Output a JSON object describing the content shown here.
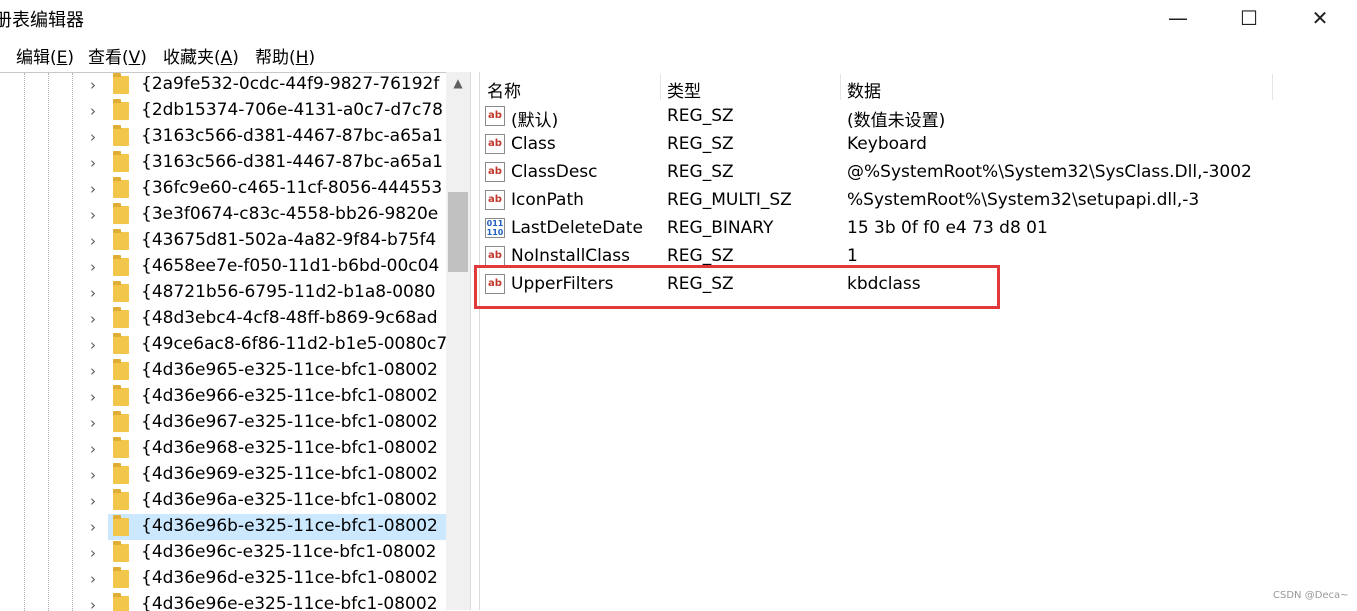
{
  "window": {
    "title": "册表编辑器",
    "minimize_glyph": "—",
    "maximize_glyph": "☐",
    "close_glyph": "✕"
  },
  "menu": [
    {
      "label": "编辑(",
      "accel": "E",
      "tail": ")"
    },
    {
      "label": "查看(",
      "accel": "V",
      "tail": ")"
    },
    {
      "label": "收藏夹(",
      "accel": "A",
      "tail": ")"
    },
    {
      "label": "帮助(",
      "accel": "H",
      "tail": ")"
    }
  ],
  "tree": {
    "expand_glyph": "›",
    "selected_index": 17,
    "items": [
      "{2a9fe532-0cdc-44f9-9827-76192f",
      "{2db15374-706e-4131-a0c7-d7c78",
      "{3163c566-d381-4467-87bc-a65a1",
      "{3163c566-d381-4467-87bc-a65a1",
      "{36fc9e60-c465-11cf-8056-444553",
      "{3e3f0674-c83c-4558-bb26-9820e",
      "{43675d81-502a-4a82-9f84-b75f4",
      "{4658ee7e-f050-11d1-b6bd-00c04",
      "{48721b56-6795-11d2-b1a8-0080",
      "{48d3ebc4-4cf8-48ff-b869-9c68ad",
      "{49ce6ac8-6f86-11d2-b1e5-0080c7",
      "{4d36e965-e325-11ce-bfc1-08002",
      "{4d36e966-e325-11ce-bfc1-08002",
      "{4d36e967-e325-11ce-bfc1-08002",
      "{4d36e968-e325-11ce-bfc1-08002",
      "{4d36e969-e325-11ce-bfc1-08002",
      "{4d36e96a-e325-11ce-bfc1-08002",
      "{4d36e96b-e325-11ce-bfc1-08002",
      "{4d36e96c-e325-11ce-bfc1-08002",
      "{4d36e96d-e325-11ce-bfc1-08002",
      "{4d36e96e-e325-11ce-bfc1-08002"
    ]
  },
  "list": {
    "columns": {
      "name": "名称",
      "type": "类型",
      "data": "数据"
    },
    "rows": [
      {
        "icon": "string-value-icon",
        "icon_text": "ab",
        "name": "(默认)",
        "type": "REG_SZ",
        "data": "(数值未设置)"
      },
      {
        "icon": "string-value-icon",
        "icon_text": "ab",
        "name": "Class",
        "type": "REG_SZ",
        "data": "Keyboard"
      },
      {
        "icon": "string-value-icon",
        "icon_text": "ab",
        "name": "ClassDesc",
        "type": "REG_SZ",
        "data": "@%SystemRoot%\\System32\\SysClass.Dll,-3002"
      },
      {
        "icon": "string-value-icon",
        "icon_text": "ab",
        "name": "IconPath",
        "type": "REG_MULTI_SZ",
        "data": "%SystemRoot%\\System32\\setupapi.dll,-3"
      },
      {
        "icon": "binary-value-icon",
        "icon_text": "011 110",
        "name": "LastDeleteDate",
        "type": "REG_BINARY",
        "data": "15 3b 0f f0 e4 73 d8 01"
      },
      {
        "icon": "string-value-icon",
        "icon_text": "ab",
        "name": "NoInstallClass",
        "type": "REG_SZ",
        "data": "1"
      },
      {
        "icon": "string-value-icon",
        "icon_text": "ab",
        "name": "UpperFilters",
        "type": "REG_SZ",
        "data": "kbdclass"
      }
    ]
  },
  "highlight_color": "#e0393b",
  "watermark": "CSDN @Deca~"
}
